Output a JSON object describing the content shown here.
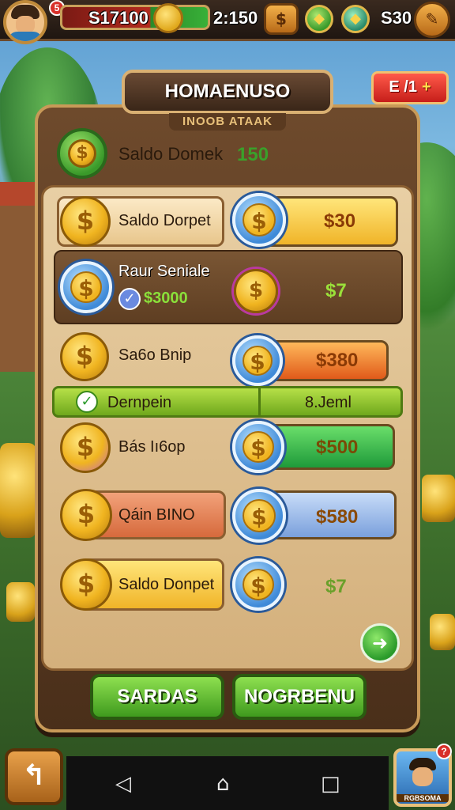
{
  "hud": {
    "coins_value": "S17100",
    "timer": "2:150",
    "gems_value": "S30",
    "notif_badge": "5"
  },
  "top_right": {
    "label": "E /1",
    "plus": "+"
  },
  "panel": {
    "title": "HOMAENUSO",
    "subtitle": "INOOB ATAAK",
    "header_label": "Saldo Domek",
    "header_value": "150"
  },
  "rows": [
    {
      "label": "Saldo Dorpet",
      "value": "$30"
    },
    {
      "label": "Raur Seniale",
      "sub_value": "$3000",
      "value": "$7"
    },
    {
      "label": "Sa6o Bnip",
      "value": "$380"
    },
    {
      "label": "Bás Iı6op",
      "value": "$500"
    },
    {
      "label": "Qáin BINO",
      "value": "$580"
    },
    {
      "label": "Saldo Donpet",
      "value": "$7"
    }
  ],
  "status_strip": {
    "left": "Dernpein",
    "right": "8.Jeml"
  },
  "buttons": {
    "primary": "SARDAS",
    "secondary": "NOGRBENU"
  },
  "profile_label": "RGBSOMA",
  "colors": {
    "accent_gold": "#f0b420",
    "panel_wood": "#6e4a2c",
    "green": "#3f9a1e",
    "red": "#c61e1a"
  },
  "icons": [
    "back-arrow-icon",
    "home-icon",
    "recents-icon",
    "coin-icon",
    "gem-icon",
    "check-icon",
    "go-arrow-icon"
  ]
}
